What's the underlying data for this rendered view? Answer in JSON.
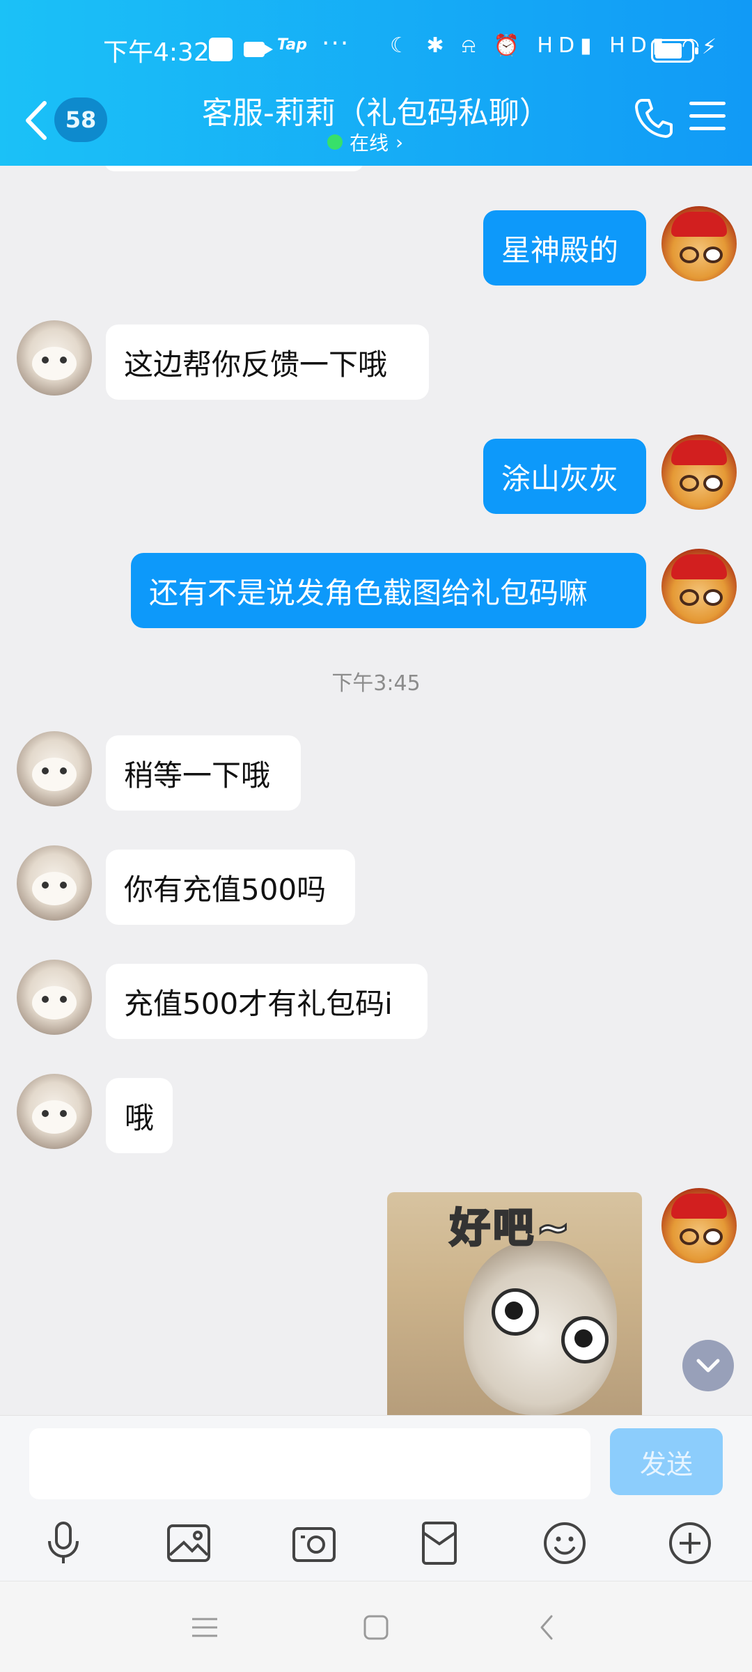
{
  "status_bar": {
    "time": "下午4:32",
    "tap_label": "Tap",
    "overflow": "···",
    "indicators": "☾ ✱ ⍾ ⏰ HD▮ HD▮ ◠"
  },
  "header": {
    "unread_count": "58",
    "title": "客服-莉莉（礼包码私聊）",
    "status": "在线",
    "status_chevron": "›"
  },
  "messages": [
    {
      "side": "right",
      "text": "星神殿的"
    },
    {
      "side": "left",
      "text": "这边帮你反馈一下哦"
    },
    {
      "side": "right",
      "text": "涂山灰灰"
    },
    {
      "side": "right",
      "text": "还有不是说发角色截图给礼包码嘛"
    },
    {
      "type": "timestamp",
      "text": "下午3:45"
    },
    {
      "side": "left",
      "text": "稍等一下哦"
    },
    {
      "side": "left",
      "text": "你有充值500吗"
    },
    {
      "side": "left",
      "text": "充值500才有礼包码i"
    },
    {
      "side": "left",
      "text": "哦"
    }
  ],
  "sticker": {
    "caption": "好吧~"
  },
  "composer": {
    "input_value": "",
    "send_label": "发送"
  },
  "colors": {
    "header_start": "#1bc1f7",
    "header_end": "#119af6",
    "outgoing_bubble": "#0d99fa",
    "incoming_bubble": "#ffffff",
    "send_button_disabled": "#8ccdfc",
    "online_dot": "#37e06a"
  },
  "icons": {
    "toolbar": [
      "microphone-icon",
      "image-icon",
      "camera-icon",
      "red-packet-icon",
      "emoji-icon",
      "plus-icon"
    ],
    "navbar": [
      "menu-icon",
      "home-icon",
      "back-icon"
    ]
  }
}
